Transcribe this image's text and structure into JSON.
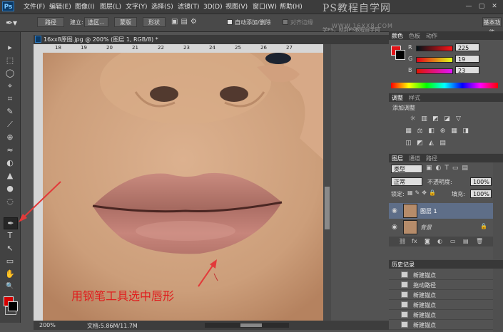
{
  "app": {
    "logo": "Ps",
    "menu": [
      "文件(F)",
      "编辑(E)",
      "图像(I)",
      "图层(L)",
      "文字(Y)",
      "选择(S)",
      "滤镜(T)",
      "3D(D)",
      "视图(V)",
      "窗口(W)",
      "帮助(H)"
    ],
    "watermark": {
      "title": "PS教程自学网",
      "subtitle": "学PS，就到PS教程自学网",
      "url": "WWW.16XX8.COM"
    },
    "window_controls": [
      "—",
      "▢",
      "✕"
    ]
  },
  "options_bar": {
    "path_mode": "路径",
    "make_label": "建立:",
    "selection_btn": "选区...",
    "mask_btn": "蒙版",
    "shape_btn": "形状",
    "auto_add_delete": "自动添加/删除",
    "align_edges": "对齐边缘",
    "workspace": "基本功能"
  },
  "toolbar": {
    "tools": [
      "▸",
      "⬚",
      "◯",
      "⌖",
      "⌗",
      "✎",
      "⟋",
      "⊕",
      "≈",
      "◐",
      "▲",
      "●",
      "◌",
      "✒",
      "T",
      "↖",
      "▭",
      "✋",
      "🔍"
    ],
    "fg_color": "#d40000",
    "bg_color": "#000000"
  },
  "document": {
    "tab_label": "16xx8原图.jpg @ 200% (图层 1, RGB/8) *",
    "ruler_numbers": [
      "18",
      "19",
      "20",
      "21",
      "22",
      "23",
      "24",
      "25",
      "26",
      "27"
    ],
    "annotation": "用钢笔工具选中唇形",
    "zoom": "200%",
    "doc_size": "文档:5.86M/11.7M"
  },
  "color_panel": {
    "tabs": [
      "颜色",
      "色板",
      "动作"
    ],
    "channels": [
      {
        "label": "R",
        "value": "225"
      },
      {
        "label": "G",
        "value": "19"
      },
      {
        "label": "B",
        "value": "23"
      }
    ],
    "swatch": "#e11317"
  },
  "adjust_panel": {
    "tabs": [
      "调整",
      "样式"
    ],
    "heading": "添加调整",
    "icons": [
      "☼",
      "▥",
      "◩",
      "◪",
      "▽",
      "▦",
      "⚖",
      "◧",
      "⊛",
      "▦",
      "◨",
      "◫",
      "◩",
      "◭",
      "▤"
    ]
  },
  "layers_panel": {
    "tabs": [
      "图层",
      "通道",
      "路径"
    ],
    "filter": "类型",
    "blend_mode": "正常",
    "opacity_label": "不透明度:",
    "opacity": "100%",
    "lock_label": "锁定:",
    "fill_label": "填充:",
    "fill": "100%",
    "layers": [
      {
        "name": "图层 1",
        "selected": true
      },
      {
        "name": "背景",
        "selected": false
      }
    ],
    "footer_icons": [
      "⛓",
      "fx",
      "◙",
      "◐",
      "▭",
      "▤",
      "🗑"
    ]
  },
  "history_panel": {
    "tabs": [
      "历史记录"
    ],
    "items": [
      "新建锚点",
      "拖动路径",
      "新建锚点",
      "新建锚点",
      "新建锚点",
      "新建锚点"
    ]
  }
}
